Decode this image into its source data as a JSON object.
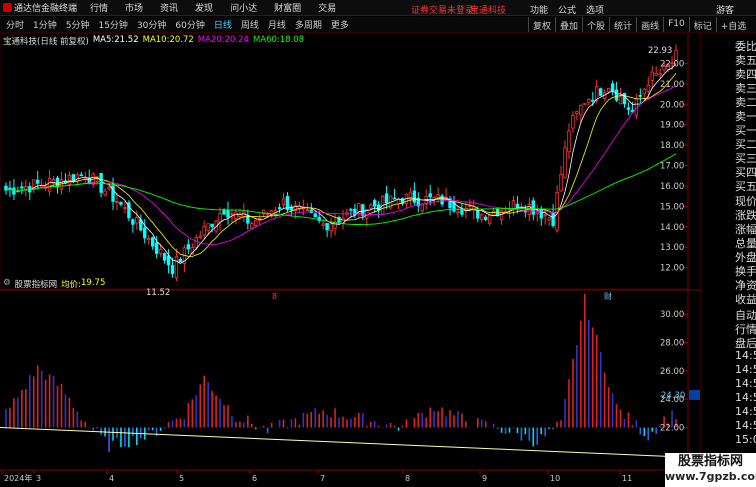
{
  "app": {
    "title": "通达信金融终端",
    "menu": [
      "行情",
      "市场",
      "资讯",
      "发现",
      "问小达",
      "财富圈",
      "交易"
    ],
    "login_status": "证券交易未登录",
    "stock_link": "宝通科技",
    "right_menu": [
      "功能",
      "公式",
      "选项"
    ],
    "guest": "游客"
  },
  "toolbar": {
    "periods": [
      "分时",
      "1分钟",
      "5分钟",
      "15分钟",
      "30分钟",
      "60分钟",
      "日线",
      "周线",
      "月线",
      "多周期",
      "更多"
    ],
    "active": "日线",
    "right_buttons": [
      "复权",
      "叠加",
      "个股",
      "统计",
      "画线",
      "F10",
      "标记",
      "+自选"
    ]
  },
  "main_chart": {
    "title": "宝通科技(日线 前复权)",
    "ma": [
      {
        "label": "MA5:",
        "value": "21.52",
        "color": "#ffffff"
      },
      {
        "label": "MA10:",
        "value": "20.72",
        "color": "#ffff00"
      },
      {
        "label": "MA20:",
        "value": "20.24",
        "color": "#ff00ff"
      },
      {
        "label": "MA60:",
        "value": "18.08",
        "color": "#00ff00"
      }
    ],
    "y_ticks": [
      "22.00",
      "21.00",
      "20.00",
      "19.00",
      "18.00",
      "17.00",
      "16.00",
      "15.00",
      "14.00",
      "13.00",
      "12.00"
    ],
    "high_label": "22.93",
    "low_label": "11.52",
    "markers": [
      "8",
      "财"
    ]
  },
  "sub_chart": {
    "title": "股票指标网",
    "avg_label": "均价:",
    "avg_value": "19.75",
    "y_ticks": [
      "30.00",
      "28.00",
      "26.00",
      "24.00",
      "22.00"
    ],
    "current_value": "24.30"
  },
  "x_axis": {
    "labels": [
      "2024年",
      "3",
      "4",
      "5",
      "6",
      "7",
      "8",
      "9",
      "10",
      "11"
    ]
  },
  "sidebar": {
    "labels": [
      "委比",
      "卖五",
      "卖四",
      "卖三",
      "卖二",
      "卖一",
      "买一",
      "买二",
      "买三",
      "买四",
      "买五",
      "现价",
      "涨跌",
      "涨幅",
      "总量",
      "外盘",
      "换手",
      "净资",
      "收益"
    ],
    "labels2": [
      "自动",
      "行情",
      "盘后",
      "14:5",
      "14:5",
      "14:5",
      "14:5",
      "14:5",
      "14:5",
      "15:0"
    ]
  },
  "watermark": {
    "title": "股票指标网",
    "url": "www.7gpzb.com"
  },
  "colors": {
    "up": "#ff3232",
    "down": "#00ffff",
    "ma5": "#ffffff",
    "ma10": "#ffff00",
    "ma20": "#ff00ff",
    "ma60": "#00ff00",
    "grid": "#400000"
  },
  "chart_data": {
    "type": "candlestick",
    "x": [
      "2024-01",
      "2024-03",
      "2024-04",
      "2024-05",
      "2024-06",
      "2024-07",
      "2024-08",
      "2024-09",
      "2024-10",
      "2024-11"
    ],
    "close": [
      15.8,
      15.2,
      13.6,
      14.2,
      15.0,
      15.1,
      15.1,
      14.8,
      20.0,
      21.6
    ],
    "ma60_end": 18.08,
    "high": 22.93,
    "low": 11.52,
    "ylim": [
      11.52,
      22.93
    ]
  }
}
